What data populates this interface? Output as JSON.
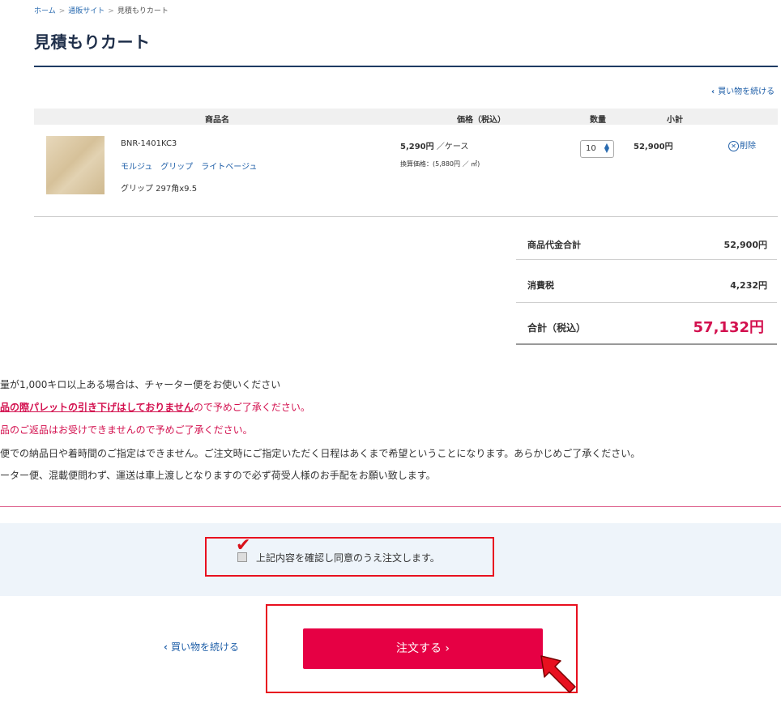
{
  "breadcrumb": {
    "home": "ホーム",
    "section": "通販サイト",
    "current": "見積もりカート",
    "separator": ">"
  },
  "page_title": "見積もりカート",
  "continue_shopping_label": "買い物を続ける",
  "table": {
    "headers": {
      "product": "商品名",
      "price": "価格（税込）",
      "quantity": "数量",
      "subtotal": "小計"
    },
    "item": {
      "sku": "BNR-1401KC3",
      "name": "モルジュ　グリップ　ライトベージュ",
      "spec": "グリップ 297角x9.5",
      "price": "5,290円",
      "price_unit": "／ケース",
      "conv_price": "換算価格：(5,880円 ／ ㎡)",
      "quantity": "10",
      "subtotal": "52,900円",
      "delete_label": "削除"
    }
  },
  "summary": {
    "goods_total_label": "商品代金合計",
    "goods_total_value": "52,900円",
    "tax_label": "消費税",
    "tax_value": "4,232円",
    "total_label": "合計（税込）",
    "total_value": "57,132円"
  },
  "notes": {
    "n1": "量が1,000キロ以上ある場合は、チャーター便をお使いください",
    "n2_emph": "品の際パレットの引き下げはしておりません",
    "n2_rest": "ので予めご了承ください。",
    "n3": "品のご返品はお受けできませんので予めご了承ください。",
    "n4": "便での納品日や着時間のご指定はできません。ご注文時にご指定いただく日程はあくまで希望ということになります。あらかじめご了承ください。",
    "n5": "ーター便、混載便問わず、運送は車上渡しとなりますので必ず荷受人様のお手配をお願い致します。"
  },
  "agreement": {
    "label": "上記内容を確認し同意のうえ注文します。",
    "checked": true
  },
  "order_button_label": "注文する ›",
  "colors": {
    "accent": "#e60044",
    "navy": "#1f3b63",
    "link": "#1f5fa8",
    "highlight": "#e8101f"
  },
  "icons": [
    "chevron-left-icon",
    "close-circle-icon",
    "spinner-icon",
    "checkmark-icon",
    "cursor-arrow-icon"
  ]
}
